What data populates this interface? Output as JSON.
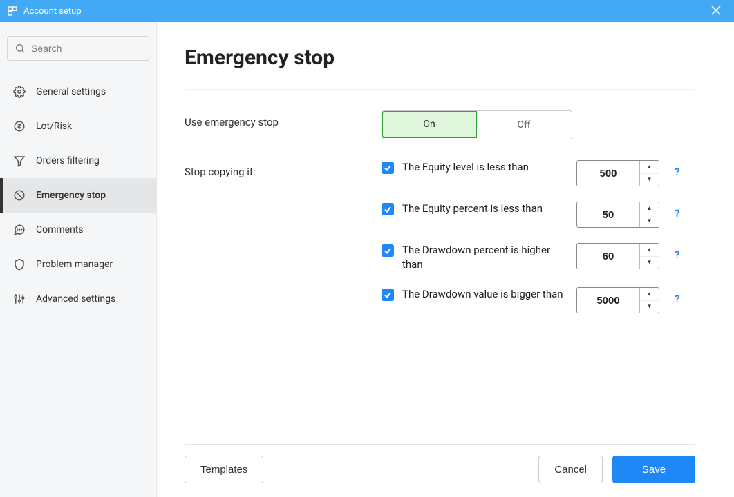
{
  "titlebar": {
    "title": "Account setup"
  },
  "search": {
    "placeholder": "Search"
  },
  "sidebar": {
    "items": [
      {
        "label": "General settings"
      },
      {
        "label": "Lot/Risk"
      },
      {
        "label": "Orders filtering"
      },
      {
        "label": "Emergency stop"
      },
      {
        "label": "Comments"
      },
      {
        "label": "Problem manager"
      },
      {
        "label": "Advanced settings"
      }
    ],
    "active_index": 3
  },
  "page": {
    "heading": "Emergency stop",
    "use_label": "Use emergency stop",
    "toggle": {
      "on": "On",
      "off": "Off",
      "value": "On"
    },
    "stop_label": "Stop copying if:",
    "conditions": [
      {
        "label": "The Equity level is less than",
        "value": "500",
        "checked": true
      },
      {
        "label": "The Equity percent is less than",
        "value": "50",
        "checked": true
      },
      {
        "label": "The Drawdown percent is higher than",
        "value": "60",
        "checked": true
      },
      {
        "label": "The Drawdown value is bigger than",
        "value": "5000",
        "checked": true
      }
    ],
    "help_glyph": "?"
  },
  "footer": {
    "templates": "Templates",
    "cancel": "Cancel",
    "save": "Save"
  }
}
